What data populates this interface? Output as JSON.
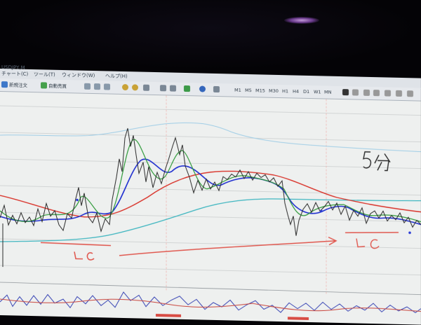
{
  "menu": {
    "title_fragment": "USDJPY,M",
    "items": [
      "チャート(C)",
      "ツール(T)",
      "ウィンドウ(W)",
      "ヘルプ(H)"
    ]
  },
  "toolbar": {
    "new_order_label": "新規注文",
    "auto_trade_label": "自動売買",
    "timeframes": [
      "M1",
      "M5",
      "M15",
      "M30",
      "H1",
      "H4",
      "D1",
      "W1",
      "MN"
    ]
  },
  "annotations": {
    "timeframe_note": "5分",
    "lc_left": "LC",
    "lc_right": "LC"
  },
  "colors": {
    "screen_bg": "#eceeef",
    "ma_red": "#d9342b",
    "ma_blue": "#1f2fd0",
    "ma_green": "#2f9a3a",
    "ma_teal": "#3fb6c0",
    "price_dark": "#2b2b2b",
    "handwriting_red": "#e0584f",
    "handwriting_dark": "#2a2a2a"
  }
}
